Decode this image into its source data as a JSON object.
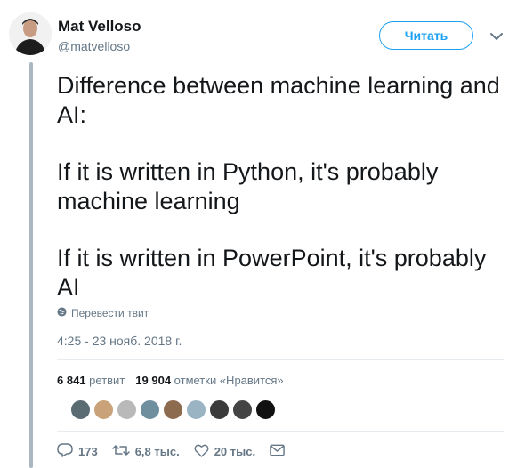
{
  "author": {
    "name": "Mat Velloso",
    "handle": "@matvelloso"
  },
  "follow_button": {
    "label": "Читать"
  },
  "tweet": {
    "paragraphs": [
      "Difference between machine learning and AI:",
      "If it is written in Python, it's probably machine learning",
      "If it is written in PowerPoint, it's probably AI"
    ]
  },
  "translate": {
    "label": "Перевести твит",
    "icon": "globe-icon"
  },
  "timestamp": "4:25 - 23 нояб. 2018 г.",
  "stats": {
    "retweets_count": "6 841",
    "retweets_label": "ретвит",
    "likes_count": "19 904",
    "likes_label": "отметки «Нравится»"
  },
  "likers": [
    {
      "color": "#5a6b72"
    },
    {
      "color": "#c9a27a"
    },
    {
      "color": "#b9b9b9"
    },
    {
      "color": "#6f8f9f"
    },
    {
      "color": "#8d6b4f"
    },
    {
      "color": "#9ab4c4"
    },
    {
      "color": "#3b3b3b"
    },
    {
      "color": "#444444"
    },
    {
      "color": "#111111"
    }
  ],
  "actions": {
    "reply_count": "173",
    "retweet_count": "6,8 тыс.",
    "like_count": "20 тыс."
  },
  "colors": {
    "accent": "#1da1f2",
    "muted": "#657786",
    "text": "#14171a",
    "thread_line": "#aab8c2"
  }
}
